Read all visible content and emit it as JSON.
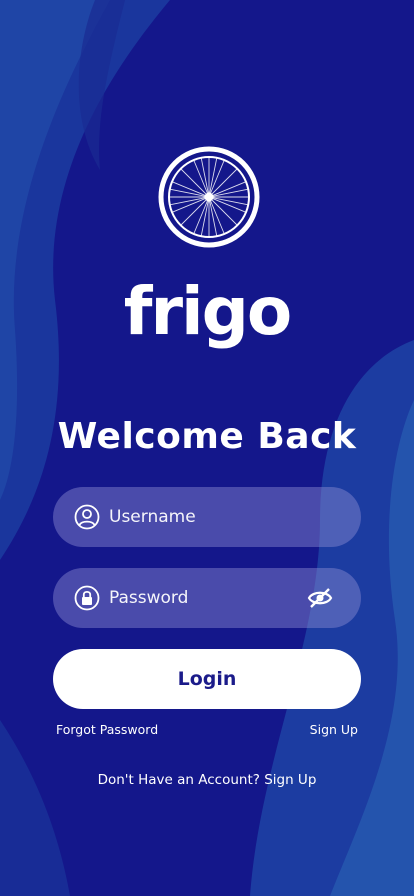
{
  "brand": {
    "name": "frigo",
    "logo_icon": "bicycle-wheel-icon"
  },
  "heading": "Welcome Back",
  "form": {
    "username_placeholder": "Username",
    "password_placeholder": "Password",
    "username_icon": "user-icon",
    "password_icon": "lock-icon",
    "visibility_icon": "eye-off-icon",
    "login_label": "Login"
  },
  "links": {
    "forgot": "Forgot Password",
    "signup": "Sign Up",
    "bottom": "Don't Have an Account? Sign Up"
  },
  "colors": {
    "background": "#12168a",
    "accent_wave": "#1f4aa8",
    "button_text": "#1b1b8a",
    "field_fill": "#8c8cd2"
  }
}
